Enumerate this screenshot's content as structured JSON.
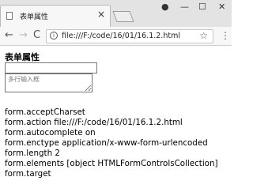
{
  "browser": {
    "tab_title": "表单属性",
    "url": "file:///F:/code/16/01/16.1.2.html",
    "icons": {
      "back": "back-arrow-icon",
      "forward": "forward-arrow-icon",
      "reload": "reload-icon",
      "star": "star-icon",
      "menu": "more-vert-icon",
      "profile": "profile-icon",
      "minimize": "minimize-icon",
      "maximize": "maximize-icon",
      "close": "close-icon"
    }
  },
  "page": {
    "heading": "表单属性",
    "text_input_value": "",
    "textarea_placeholder": "多行输入框",
    "lines": [
      "form.acceptCharset",
      "form.action file:///F:/code/16/01/16.1.2.html",
      "form.autocomplete on",
      "form.enctype application/x-www-form-urlencoded",
      "form.length 2",
      "form.elements [object HTMLFormControlsCollection]",
      "form.target"
    ]
  }
}
